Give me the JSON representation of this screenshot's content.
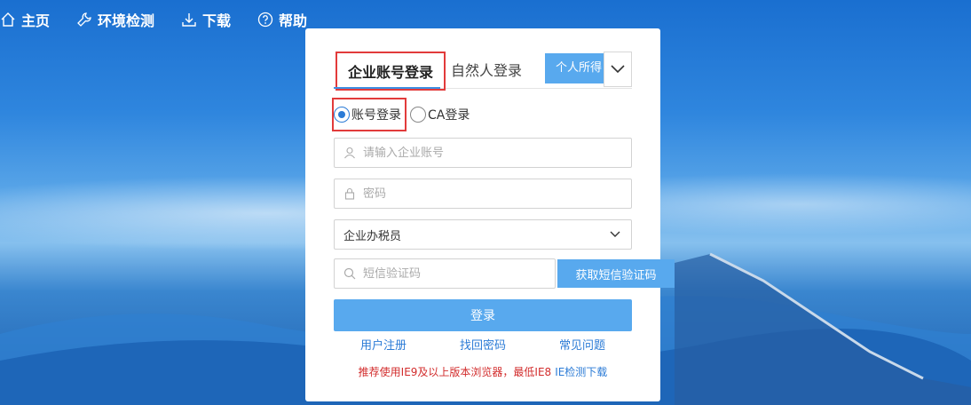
{
  "nav": {
    "items": [
      {
        "label": "主页",
        "icon": "home-icon"
      },
      {
        "label": "环境检测",
        "icon": "wrench-icon"
      },
      {
        "label": "下载",
        "icon": "download-icon"
      },
      {
        "label": "帮助",
        "icon": "help-icon"
      }
    ]
  },
  "login": {
    "tabs": {
      "enterprise": "企业账号登录",
      "natural": "自然人登录",
      "personal": "个人所得"
    },
    "radios": {
      "account": "账号登录",
      "ca": "CA登录",
      "selected": "account"
    },
    "fields": {
      "account_placeholder": "请输入企业账号",
      "password_placeholder": "密码",
      "role_value": "企业办税员",
      "sms_placeholder": "短信验证码"
    },
    "sms_button": "获取短信验证码",
    "submit_button": "登录",
    "links": {
      "register": "用户注册",
      "recover": "找回密码",
      "faq": "常见问题"
    },
    "notice": {
      "text": "推荐使用IE9及以上版本浏览器，最低IE8",
      "link": "IE检测下载"
    }
  },
  "colors": {
    "accent": "#58a9ee",
    "highlight": "#e23b3b",
    "link": "#2b7bd6",
    "warning": "#d22c2c"
  }
}
